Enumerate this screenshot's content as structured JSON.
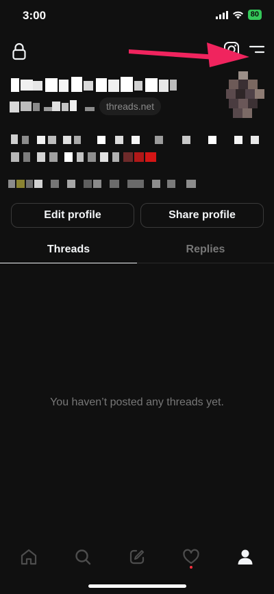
{
  "status_bar": {
    "time": "3:00",
    "battery": "80"
  },
  "profile": {
    "domain_chip": "threads.net"
  },
  "actions": {
    "edit_profile": "Edit profile",
    "share_profile": "Share profile"
  },
  "tabs": [
    {
      "label": "Threads",
      "active": true
    },
    {
      "label": "Replies",
      "active": false
    }
  ],
  "empty_state": {
    "message": "You haven’t posted any threads yet."
  },
  "bottom_nav": {
    "items": [
      "home-icon",
      "search-icon",
      "compose-icon",
      "heart-icon",
      "profile-icon"
    ],
    "active": "profile-icon"
  },
  "annotation": {
    "arrow_color": "#f0245e"
  },
  "colors": {
    "background": "#101010",
    "text": "#f3f5f7",
    "muted": "#777777",
    "accent_dot": "#ff3040"
  }
}
